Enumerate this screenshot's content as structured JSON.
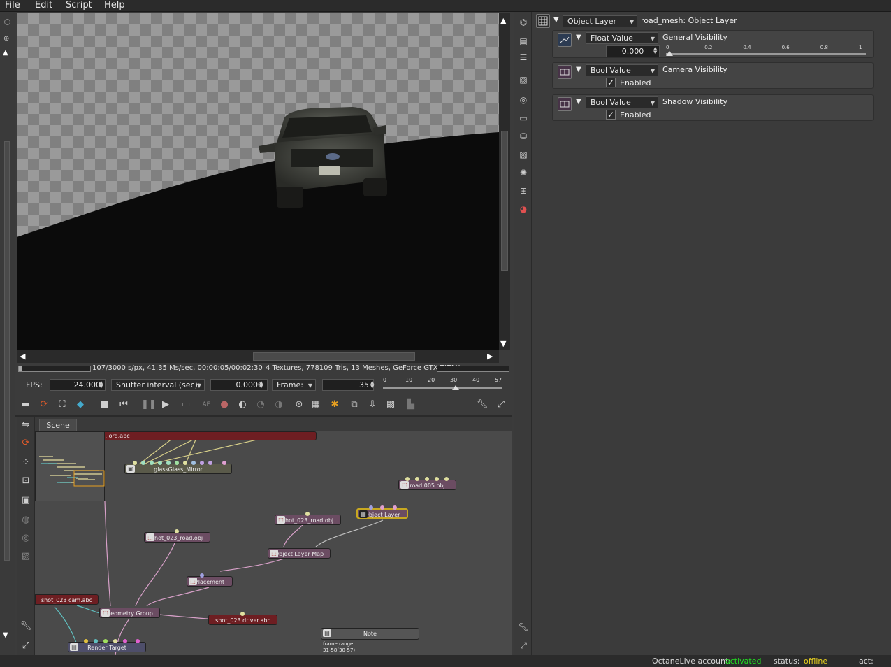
{
  "menu": {
    "file": "File",
    "edit": "Edit",
    "script": "Script",
    "help": "Help"
  },
  "status": {
    "render_stats": "107/3000 s/px, 41.35 Ms/sec, 00:00:05/00:02:30",
    "scene_stats": "4 Textures, 778109 Tris, 13 Meshes, GeForce GTX TITAN, ...",
    "progress_fraction": 0.036
  },
  "controls": {
    "fps_label": "FPS:",
    "fps_value": "24.000",
    "shutter_label": "Shutter interval (sec):",
    "shutter_value": "0.0000",
    "frame_label": "Frame:",
    "frame_value": "35",
    "timeline_ticks": [
      "0",
      "10",
      "20",
      "30",
      "40",
      "57"
    ],
    "timeline_fraction": 0.614
  },
  "node_graph": {
    "tab": "Scene",
    "nodes": {
      "cam_top": "...ord.abc",
      "glass": "glassGlass_Mirror",
      "road005": "road 005.obj",
      "shot_road_a": "shot_023_road.obj",
      "object_layer": "Object Layer",
      "shot_road_b": "shot_023_road.obj",
      "layer_map": "Object Layer Map",
      "placement": "Placement",
      "cam": "shot_023 cam.abc",
      "geo_group": "Geometry Group",
      "driver": "shot_023 driver.abc",
      "note": "Note",
      "render_target": "Render Target"
    },
    "note_text": [
      "frame range:",
      "31-58(30-57)"
    ]
  },
  "inspector": {
    "header": {
      "type": "Object Layer",
      "title": "road_mesh:  Object Layer"
    },
    "general": {
      "type": "Float Value",
      "label": "General Visibility",
      "value": "0.000",
      "ticks": [
        "0",
        "0.2",
        "0.4",
        "0.6",
        "0.8",
        "1"
      ],
      "slider_fraction": 0.0
    },
    "camera": {
      "type": "Bool Value",
      "label": "Camera Visibility",
      "check_label": "Enabled",
      "checked": true
    },
    "shadow": {
      "type": "Bool Value",
      "label": "Shadow Visibility",
      "check_label": "Enabled",
      "checked": true
    }
  },
  "footer": {
    "account_label": "OctaneLive account:",
    "account_value": "activated",
    "status_label": "status:",
    "status_value": "offline",
    "act_label": "act:",
    "colors": {
      "activated": "#22dd22",
      "offline": "#e8d020"
    }
  }
}
